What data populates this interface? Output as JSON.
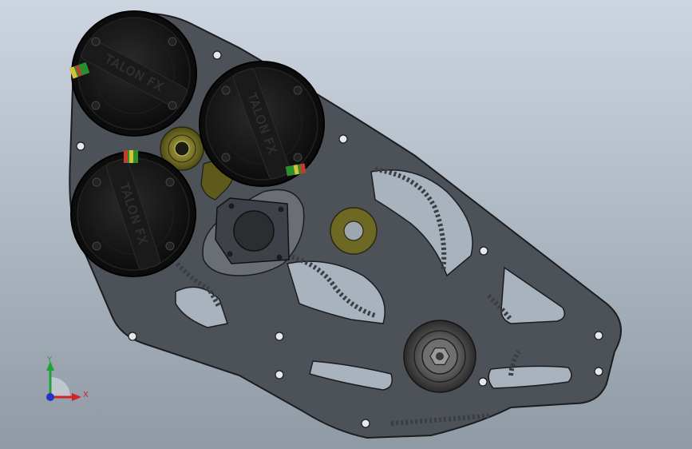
{
  "viewport": {
    "background_top": "#cdd6e0",
    "background_bottom": "#8f9aa5"
  },
  "model": {
    "plate_color": "#4d5158",
    "plate_edge": "#1b1d20",
    "cutout_color": "#a9b3bd",
    "gear_color": "#3b3f45",
    "bushing_color": "#5e5a1c",
    "bushing_highlight": "#8f8930"
  },
  "motors": [
    {
      "label": "TALON FX"
    },
    {
      "label": "TALON FX"
    },
    {
      "label": "TALON FX"
    }
  ],
  "triad": {
    "y_label": "Y",
    "x_label": "X",
    "y_color": "#1fa23a",
    "x_color": "#d42323",
    "z_color": "#2335c9"
  }
}
